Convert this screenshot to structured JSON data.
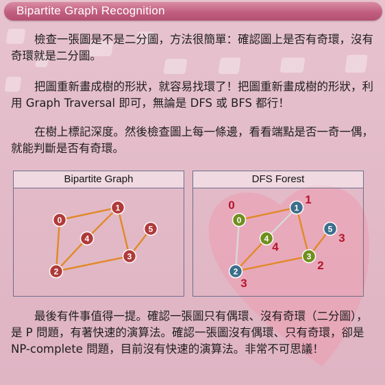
{
  "header": {
    "title": "Bipartite Graph Recognition"
  },
  "paragraphs": [
    "檢查一張圖是不是二分圖，方法很簡單：確認圖上是否有奇環，沒有奇環就是二分圖。",
    "把圖重新畫成樹的形狀，就容易找環了！把圖重新畫成樹的形狀，利用 Graph Traversal 即可，無論是 DFS 或 BFS 都行！",
    "在樹上標記深度。然後檢查圖上每一條邊，看看端點是否一奇一偶，就能判斷是否有奇環。",
    "最後有件事值得一提。確認一張圖只有偶環、沒有奇環（二分圖），是 P 問題，有著快速的演算法。確認一張圖沒有偶環、只有奇環，卻是 NP-complete 問題，目前沒有快速的演算法。非常不可思議！"
  ],
  "left_panel": {
    "title": "Bipartite Graph",
    "nodes": [
      "0",
      "1",
      "2",
      "3",
      "4",
      "5"
    ]
  },
  "right_panel": {
    "title": "DFS Forest",
    "nodes": [
      "0",
      "1",
      "2",
      "3",
      "4",
      "5"
    ],
    "depths": [
      "0",
      "1",
      "3",
      "2",
      "4",
      "3"
    ]
  },
  "colors": {
    "title_bar": "#c25f80",
    "edge": "#e08a2a",
    "node_red": "#b03a3a",
    "node_blue": "#3b6e8c",
    "node_green": "#6f8f1e",
    "depth_text": "#b5152b",
    "tree_edge_dfs": "#d8d8d8"
  }
}
